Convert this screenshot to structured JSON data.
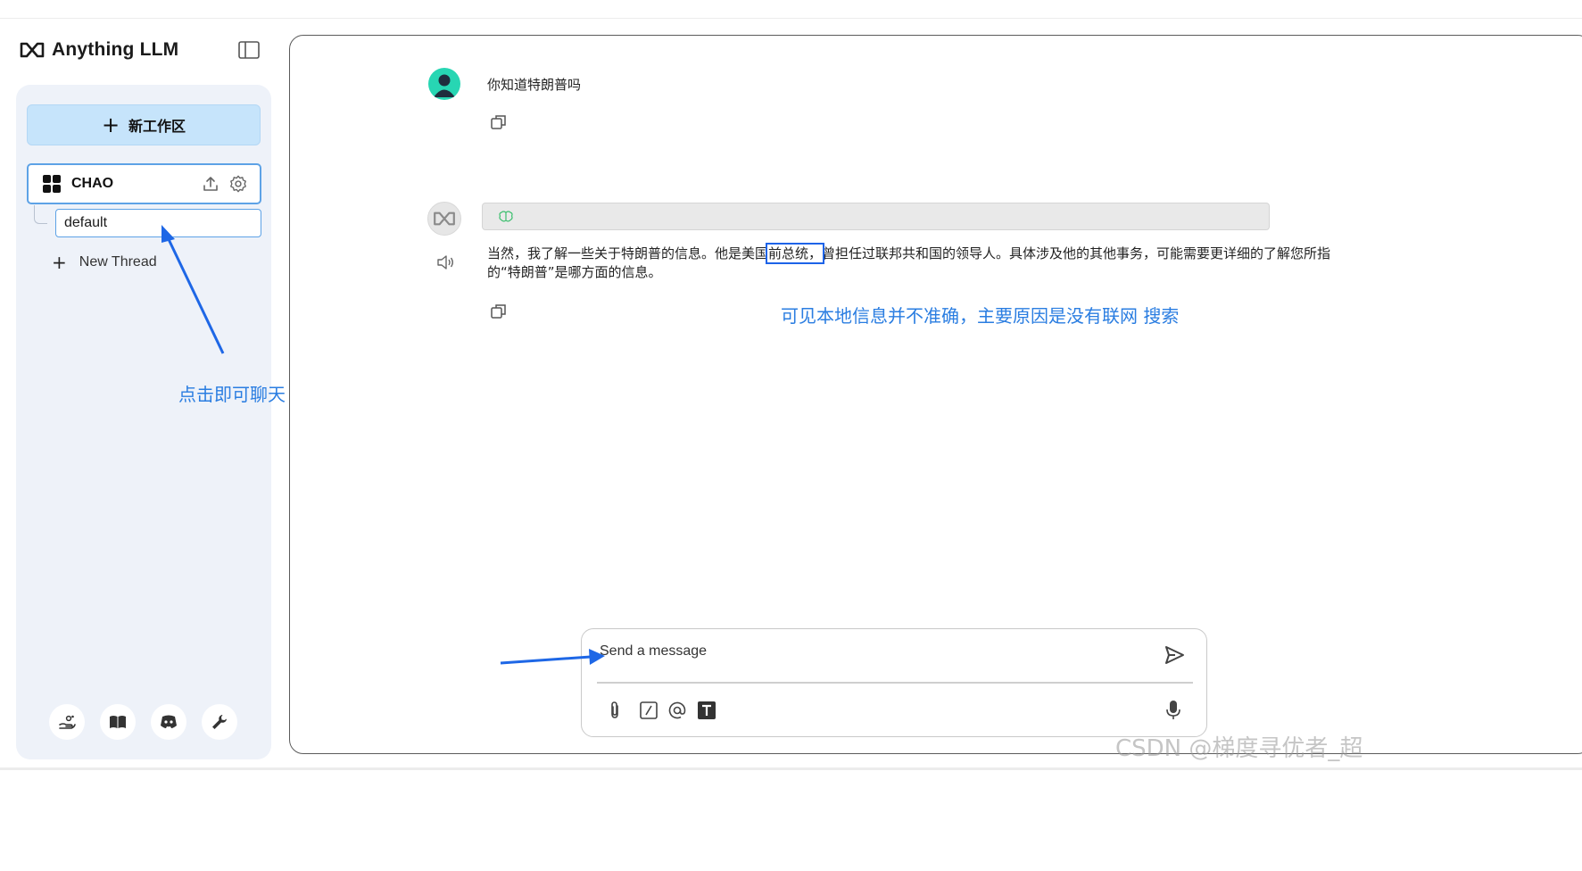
{
  "app": {
    "title": "Anything LLM"
  },
  "sidebar": {
    "new_workspace_label": "新工作区",
    "workspace": {
      "name": "CHAO",
      "threads": [
        {
          "label": "default"
        }
      ],
      "new_thread_label": "New Thread"
    },
    "footer_icons": [
      "community-hub-icon",
      "docs-icon",
      "discord-icon",
      "settings-wrench-icon"
    ]
  },
  "chat": {
    "user_message": "你知道特朗普吗",
    "assistant_message": {
      "before": "当然，我了解一些关于特朗普的信息。他是美国",
      "highlight": "前总统，",
      "after": "曾担任过联邦共和国的领导人。具体涉及他的其他事务，可能需要更详细的了解您所指的“特朗普”是哪方面的信息。"
    }
  },
  "composer": {
    "placeholder": "Send a message",
    "tools": [
      "attach-icon",
      "slash-command-icon",
      "mention-icon",
      "text-format-icon",
      "microphone-icon"
    ]
  },
  "annotations": {
    "sidebar_note": "点击即可聊天",
    "chat_note": "可见本地信息并不准确，主要原因是没有联网 搜索"
  },
  "watermark": "CSDN @梯度寻优者_超",
  "colors": {
    "accent": "#5da2e6",
    "new_workspace_bg": "#c6e4fb",
    "sidebar_bg": "#eef2f9",
    "annotation": "#2a7de1",
    "user_avatar": "#27d6b3"
  }
}
